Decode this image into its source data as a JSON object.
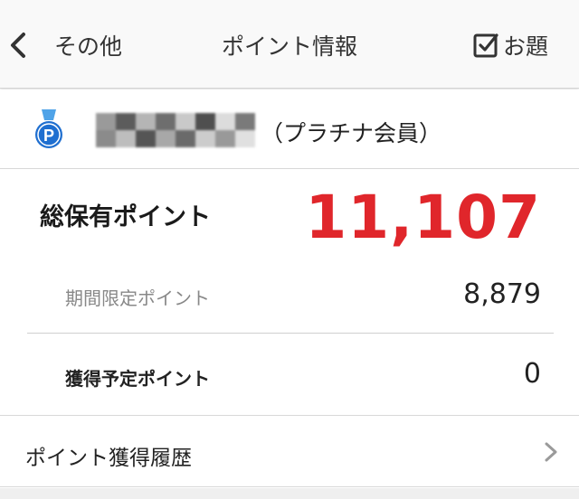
{
  "header": {
    "back_label": "その他",
    "title": "ポイント情報",
    "quiz_label": "お題"
  },
  "member": {
    "rank": "（プラチナ会員）",
    "medal_letter": "P",
    "mask_colors": [
      "#9a9a9a",
      "#5c5c5c",
      "#b5b5b5",
      "#6e6e6e",
      "#c9c9c9",
      "#4f4f4f",
      "#dcdcdc",
      "#7a7a7a",
      "#8b8b8b",
      "#bdbdbd",
      "#555555",
      "#a8a8a8",
      "#6a6a6a",
      "#cccccc",
      "#999999",
      "#e0e0e0"
    ]
  },
  "points": {
    "total_label": "総保有ポイント",
    "total_value": "11,107",
    "limited_label": "期間限定ポイント",
    "limited_value": "8,879",
    "pending_label": "獲得予定ポイント",
    "pending_value": "0"
  },
  "history": {
    "label": "ポイント獲得履歴"
  },
  "colors": {
    "accent_red": "#e0262b",
    "medal_blue": "#1f6fd0",
    "ribbon_blue": "#4fa3e8"
  }
}
